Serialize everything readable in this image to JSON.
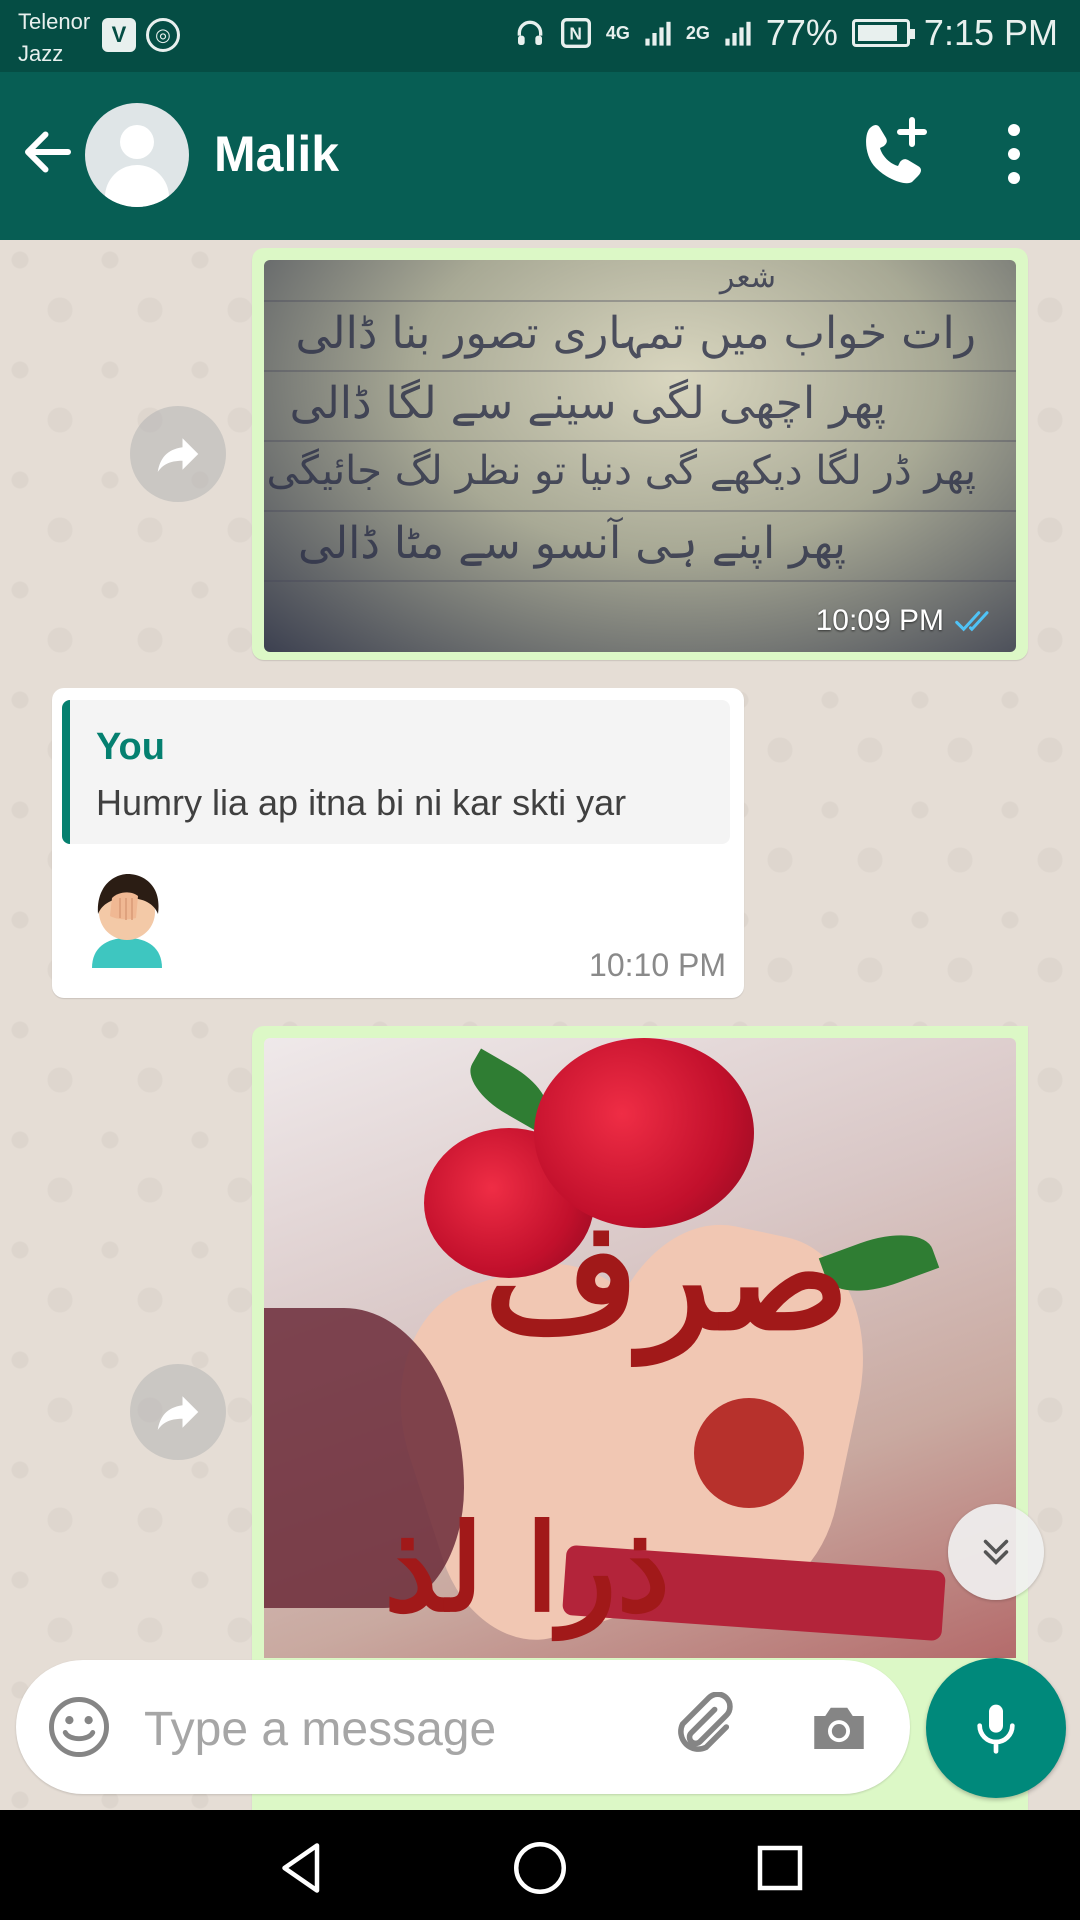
{
  "status_bar": {
    "carrier_line1": "Telenor",
    "carrier_line2": "Jazz",
    "battery_percent": "77%",
    "time": "7:15 PM",
    "network_labels": [
      "4G",
      "2G"
    ]
  },
  "header": {
    "contact_name": "Malik",
    "icons": [
      "back-arrow-icon",
      "avatar",
      "add-call-icon",
      "more-options-icon"
    ]
  },
  "messages": [
    {
      "type": "image",
      "direction": "outgoing",
      "time": "10:09 PM",
      "status": "read",
      "image_caption_urdu": [
        "شعر",
        "رات خواب میں تمہاری تصور بنا ڈالی",
        "پھر اچھی لگی سینے سے لگا ڈالی",
        "پھر ڈر لگا دیکھے گی دنیا تو نظر لگ جائیگی",
        "پھر اپنے ہی آنسو سے مٹا ڈالی"
      ]
    },
    {
      "type": "reply",
      "direction": "incoming",
      "quoted_name": "You",
      "quoted_text": "Humry lia ap itna bi ni kar skti yar",
      "body_emoji": "woman-facepalming-emoji",
      "time": "10:10 PM"
    },
    {
      "type": "image",
      "direction": "outgoing",
      "image_text_urdu": [
        "صرف",
        "ذرا لذ"
      ]
    }
  ],
  "composer": {
    "placeholder": "Type a message"
  },
  "colors": {
    "status_bar": "#054d44",
    "header": "#075e54",
    "outgoing_bubble": "#dcf8c6",
    "incoming_bubble": "#ffffff",
    "accent": "#00897b",
    "read_ticks": "#4fc3f7",
    "chat_background": "#e5ddd5"
  }
}
